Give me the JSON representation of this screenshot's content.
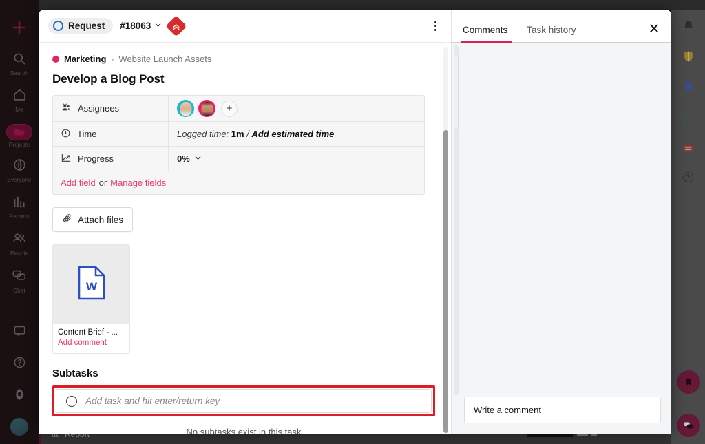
{
  "left_rail": {
    "items": [
      {
        "icon": "plus-icon",
        "label": ""
      },
      {
        "icon": "search-icon",
        "label": "Search"
      },
      {
        "icon": "home-icon",
        "label": "Me"
      },
      {
        "icon": "folder-icon",
        "label": "Projects",
        "active": true
      },
      {
        "icon": "globe-icon",
        "label": "Everyone"
      },
      {
        "icon": "chart-icon",
        "label": "Reports"
      },
      {
        "icon": "people-icon",
        "label": "People"
      },
      {
        "icon": "chat-icon",
        "label": "Chat"
      }
    ],
    "bottom_items": [
      {
        "icon": "feedback-icon",
        "label": ""
      },
      {
        "icon": "help-icon",
        "label": ""
      },
      {
        "icon": "gear-icon",
        "label": ""
      },
      {
        "icon": "user-avatar",
        "label": ""
      }
    ]
  },
  "right_rail": {
    "items": [
      {
        "icon": "bell-icon",
        "color": "#2b2b2b"
      },
      {
        "icon": "shield-icon",
        "color": "#d6a018"
      },
      {
        "icon": "bookmark-icon",
        "color": "#2c4ec4"
      },
      {
        "icon": "megaphone-icon",
        "color": "#2f5c52"
      },
      {
        "icon": "calendar-icon",
        "color": "#b03a2e"
      },
      {
        "icon": "question-icon",
        "color": "#4a4a4a"
      }
    ],
    "fabs": [
      {
        "icon": "bookmark-fab-icon"
      },
      {
        "icon": "chat-fab-icon"
      }
    ]
  },
  "background_bar": {
    "label": "Report"
  },
  "modal": {
    "header": {
      "status_label": "Request",
      "task_id": "#18063",
      "chevron": "chevron-down-icon",
      "priority_icon": "urgent-priority-icon",
      "menu_icon": "kebab-menu-icon"
    },
    "breadcrumb": {
      "project": "Marketing",
      "separator": "›",
      "list": "Website Launch Assets"
    },
    "title": "Develop a Blog Post",
    "fields": [
      {
        "icon": "assignees-icon",
        "label": "Assignees",
        "type": "avatars",
        "add_label": "+"
      },
      {
        "icon": "clock-icon",
        "label": "Time",
        "type": "time",
        "prefix": "Logged time:",
        "logged": "1m",
        "divider": "/",
        "estimate_link": "Add estimated time"
      },
      {
        "icon": "progress-icon",
        "label": "Progress",
        "type": "progress",
        "value": "0%"
      }
    ],
    "fields_footer": {
      "add_field": "Add field",
      "or": "or",
      "manage_fields": "Manage fields"
    },
    "attach_button": {
      "icon": "paperclip-icon",
      "label": "Attach files"
    },
    "attachment": {
      "file_icon": "word-doc-icon",
      "name": "Content Brief - ...",
      "comment_link": "Add comment"
    },
    "subtasks": {
      "heading": "Subtasks",
      "input_placeholder": "Add task and hit enter/return key",
      "empty_text": "No subtasks exist in this task",
      "highlight_color": "#e01b24"
    }
  },
  "comments_panel": {
    "tabs": [
      {
        "label": "Comments",
        "active": true
      },
      {
        "label": "Task history",
        "active": false
      }
    ],
    "close_icon": "close-icon",
    "composer_placeholder": "Write a comment"
  },
  "colors": {
    "accent_pink": "#ef376f",
    "tab_underline": "#d4205f",
    "highlight_red": "#e01b24",
    "priority_red": "#d92b2b",
    "status_blue": "#1d6fd0"
  }
}
